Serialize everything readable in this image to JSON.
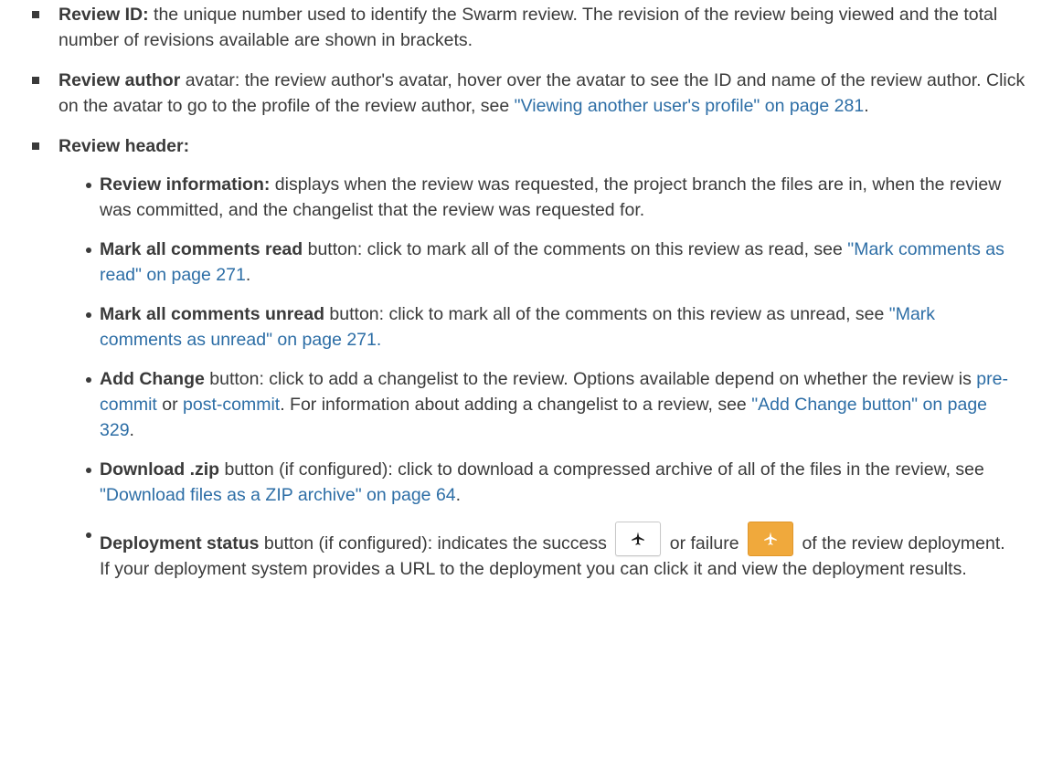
{
  "items": [
    {
      "label": "Review ID:",
      "text": " the unique number used to identify the Swarm review. The revision of the review being viewed and the total number of revisions available are shown in brackets."
    },
    {
      "label": "Review author",
      "text1": " avatar: the review author's avatar, hover over the avatar to see the ID and name of the review author. Click on the avatar to go to the profile of the review author, see ",
      "link": "\"Viewing another user's profile\" on page 281",
      "text2": "."
    },
    {
      "label": "Review header:"
    }
  ],
  "sub_items": [
    {
      "label": "Review information:",
      "text": " displays when the review was requested, the project branch the files are in, when the review was committed, and the changelist that the review was requested for."
    },
    {
      "label": "Mark all comments read",
      "text1": " button: click to mark all of the comments on this review as read, see ",
      "link": "\"Mark comments as read\" on page 271",
      "text2": "."
    },
    {
      "label": "Mark all comments unread",
      "text1": " button: click to mark all of the comments on this review as unread, see ",
      "link": "\"Mark comments as unread\" on page 271.",
      "text2": ""
    },
    {
      "label": "Add Change",
      "text1": " button: click to add a changelist to the review. Options available depend on whether the review is ",
      "link1": "pre-commit",
      "text2": " or ",
      "link2": "post-commit",
      "text3": ". For information about adding a changelist to a review, see ",
      "link3": "\"Add Change button\" on page 329",
      "text4": "."
    },
    {
      "label": "Download .zip",
      "text1": " button (if configured): click to download a compressed archive of all of the files in the review, see ",
      "link": "\"Download files as a ZIP archive\" on page 64",
      "text2": "."
    },
    {
      "label": "Deployment status",
      "text1": " button (if configured): indicates the success ",
      "text2": " or failure ",
      "text3": " of the review deployment. If your deployment system provides a URL to the deployment you can click it and view the deployment results.",
      "success_icon": "airplane-icon",
      "failure_icon": "airplane-icon"
    }
  ],
  "colors": {
    "text": "#3a3a3a",
    "link": "#2d6ea6",
    "failure_button": "#f0a93c"
  }
}
